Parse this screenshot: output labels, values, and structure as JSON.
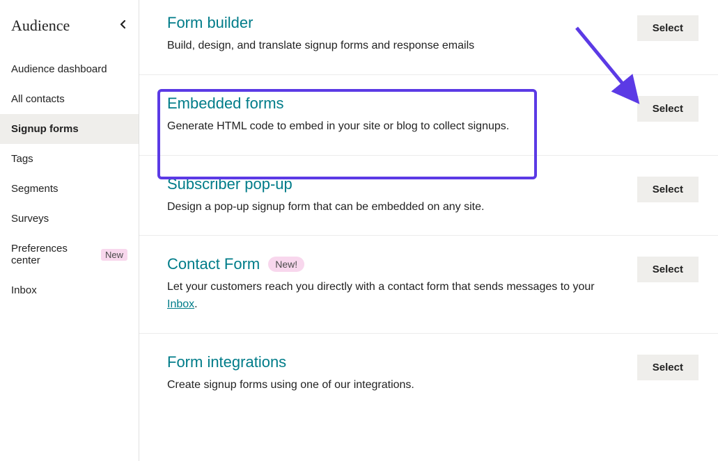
{
  "sidebar": {
    "title": "Audience",
    "items": [
      {
        "label": "Audience dashboard"
      },
      {
        "label": "All contacts"
      },
      {
        "label": "Signup forms"
      },
      {
        "label": "Tags"
      },
      {
        "label": "Segments"
      },
      {
        "label": "Surveys"
      },
      {
        "label": "Preferences center"
      },
      {
        "label": "Inbox"
      }
    ],
    "badge_new": "New"
  },
  "forms": {
    "form_builder": {
      "title": "Form builder",
      "desc": "Build, design, and translate signup forms and response emails",
      "select": "Select"
    },
    "embedded_forms": {
      "title": "Embedded forms",
      "desc": "Generate HTML code to embed in your site or blog to collect signups.",
      "select": "Select"
    },
    "subscriber_popup": {
      "title": "Subscriber pop-up",
      "desc": "Design a pop-up signup form that can be embedded on any site.",
      "select": "Select"
    },
    "contact_form": {
      "title": "Contact Form",
      "badge": "New!",
      "desc_pre": "Let your customers reach you directly with a contact form that sends messages to your ",
      "desc_link": "Inbox",
      "desc_post": ".",
      "select": "Select"
    },
    "form_integrations": {
      "title": "Form integrations",
      "desc": "Create signup forms using one of our integrations.",
      "select": "Select"
    }
  }
}
